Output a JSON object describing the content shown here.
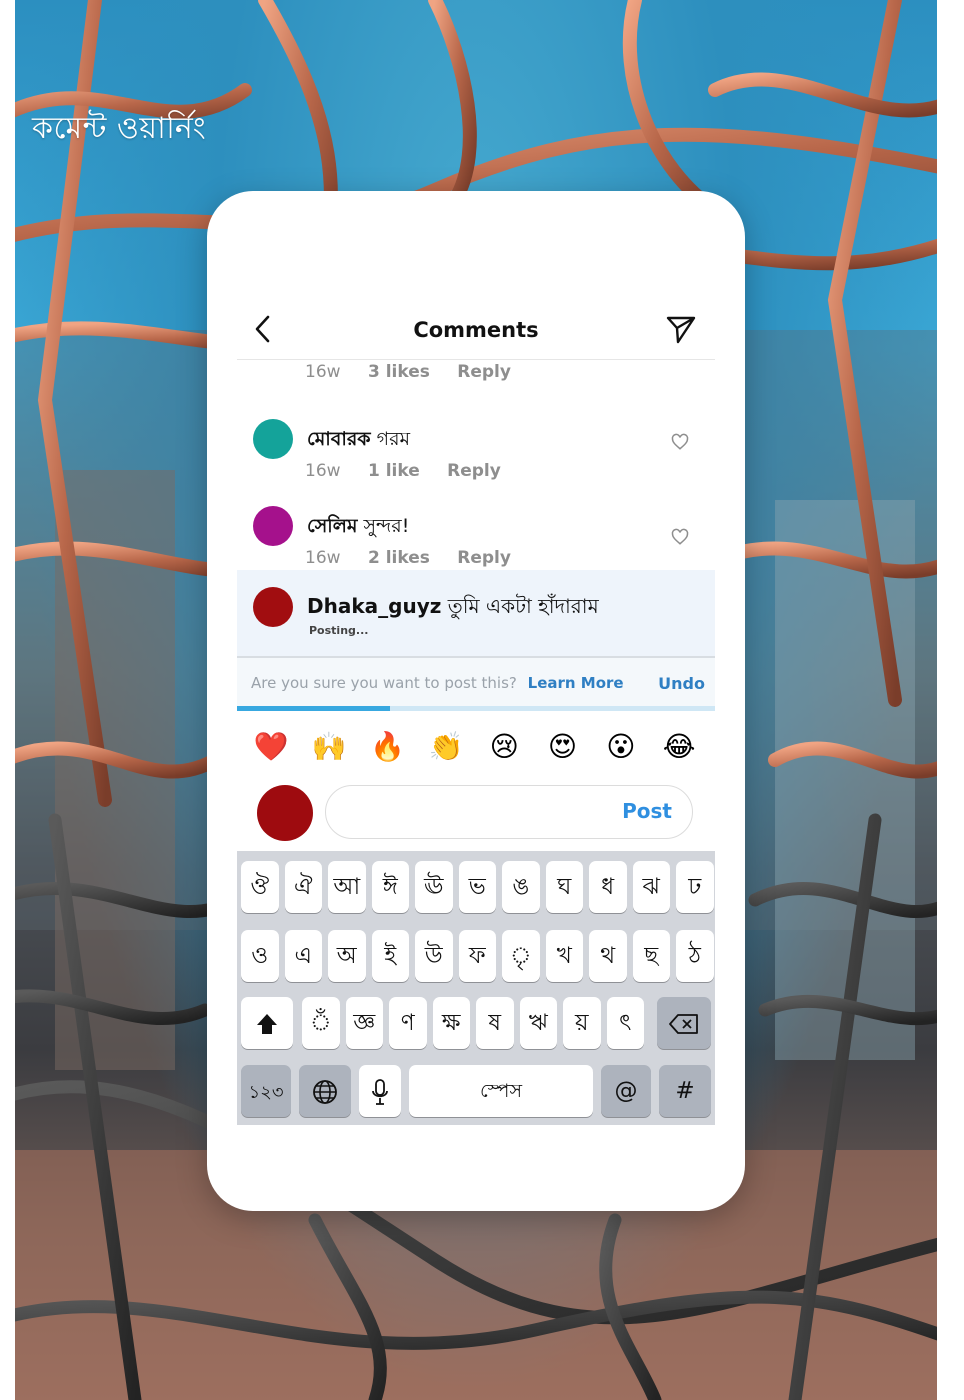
{
  "overlay": {
    "title": "কমেন্ট ওয়ার্নিং"
  },
  "header": {
    "title": "Comments",
    "back_icon": "chevron-left-icon",
    "send_icon": "paper-plane-icon"
  },
  "first_meta": {
    "time": "16w",
    "likes": "3 likes",
    "reply": "Reply"
  },
  "comments": [
    {
      "user": "মোবারক",
      "text": "গরম",
      "time": "16w",
      "likes": "1 like",
      "reply": "Reply",
      "avatar_color": "#14a39a"
    },
    {
      "user": "সেলিম",
      "text": "সুন্দর!",
      "time": "16w",
      "likes": "2 likes",
      "reply": "Reply",
      "avatar_color": "#a5118c"
    }
  ],
  "posting": {
    "user": "Dhaka_guyz",
    "text": "তুমি একটা হাঁদারাম",
    "status": "Posting...",
    "avatar_color": "#a10d10"
  },
  "warning": {
    "text": "Are you sure you want to post this?",
    "learn_more": "Learn More",
    "undo": "Undo",
    "progress": 0.32
  },
  "emojis": [
    "❤️",
    "🙌",
    "🔥",
    "👏",
    "😢",
    "😍",
    "😮",
    "😂"
  ],
  "compose": {
    "post_label": "Post",
    "placeholder": ""
  },
  "keyboard": {
    "row1": [
      "ঔ",
      "ঐ",
      "আ",
      "ঈ",
      "ঊ",
      "ভ",
      "ঙ",
      "ঘ",
      "ধ",
      "ঝ",
      "ঢ"
    ],
    "row2": [
      "ও",
      "এ",
      "অ",
      "ই",
      "উ",
      "ফ",
      "ৃ",
      "খ",
      "থ",
      "ছ",
      "ঠ"
    ],
    "row3": [
      "ঁ",
      "জ্ঞ",
      "ণ",
      "ক্ষ",
      "ষ",
      "ঋ",
      "য়",
      "ৎ"
    ],
    "numbers_key": "১২৩",
    "space_key": "স্পেস",
    "at_key": "@",
    "hash_key": "#"
  },
  "colors": {
    "accent": "#2f8fe0",
    "link": "#2f7fc3",
    "keyboard_bg": "#d2d5db"
  }
}
